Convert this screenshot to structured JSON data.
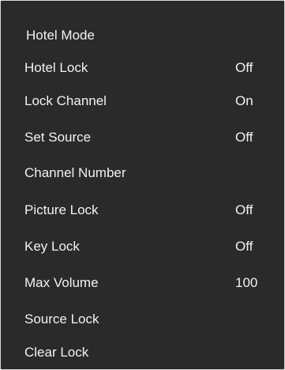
{
  "menu": {
    "title": "Hotel Mode",
    "items": [
      {
        "label": "Hotel Lock",
        "value": "Off"
      },
      {
        "label": "Lock Channel",
        "value": "On"
      },
      {
        "label": "Set Source",
        "value": "Off"
      },
      {
        "label": "Channel Number",
        "value": ""
      },
      {
        "label": "Picture Lock",
        "value": "Off"
      },
      {
        "label": "Key Lock",
        "value": "Off"
      },
      {
        "label": "Max Volume",
        "value": "100"
      },
      {
        "label": "Source Lock",
        "value": ""
      },
      {
        "label": "Clear Lock",
        "value": ""
      }
    ]
  },
  "colors": {
    "background": "#2a2a2a",
    "text": "#f2f2f2",
    "border": "#d7d7d7"
  }
}
